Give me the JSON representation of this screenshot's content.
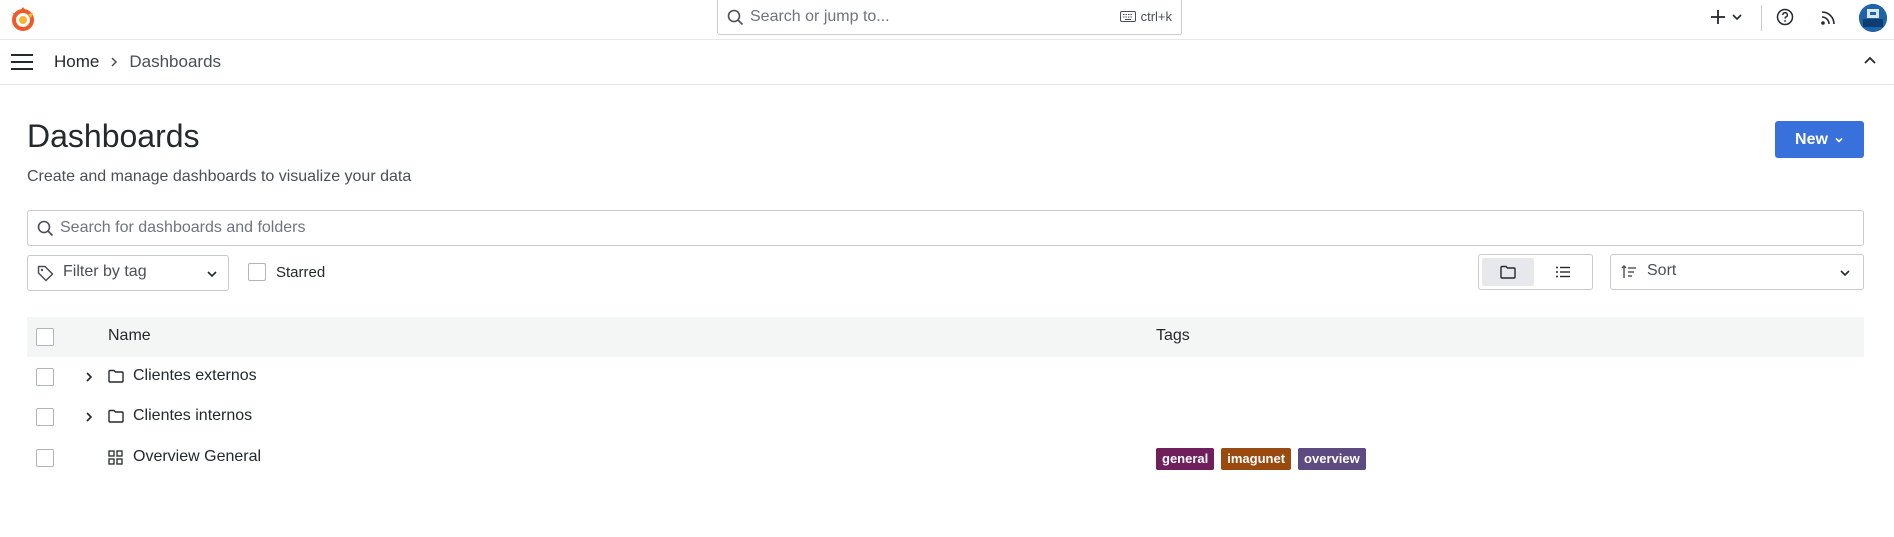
{
  "topbar": {
    "search_placeholder": "Search or jump to...",
    "search_shortcut": "ctrl+k"
  },
  "breadcrumb": {
    "home": "Home",
    "current": "Dashboards"
  },
  "page": {
    "title": "Dashboards",
    "subtitle": "Create and manage dashboards to visualize your data",
    "new_button": "New"
  },
  "search": {
    "placeholder": "Search for dashboards and folders"
  },
  "filters": {
    "tag_placeholder": "Filter by tag",
    "starred_label": "Starred",
    "sort_placeholder": "Sort",
    "view_mode": "folder"
  },
  "table": {
    "columns": [
      "Name",
      "Tags"
    ],
    "rows": [
      {
        "name": "Clientes externos",
        "kind": "folder",
        "tags": []
      },
      {
        "name": "Clientes internos",
        "kind": "folder",
        "tags": []
      },
      {
        "name": "Overview General",
        "kind": "dashboard",
        "tags": [
          {
            "label": "general",
            "color": "#6e1f5c"
          },
          {
            "label": "imagunet",
            "color": "#9b4a0f"
          },
          {
            "label": "overview",
            "color": "#5c4a80"
          }
        ]
      }
    ]
  },
  "colors": {
    "primary": "#3871dc",
    "header_bg": "#f4f5f5"
  }
}
